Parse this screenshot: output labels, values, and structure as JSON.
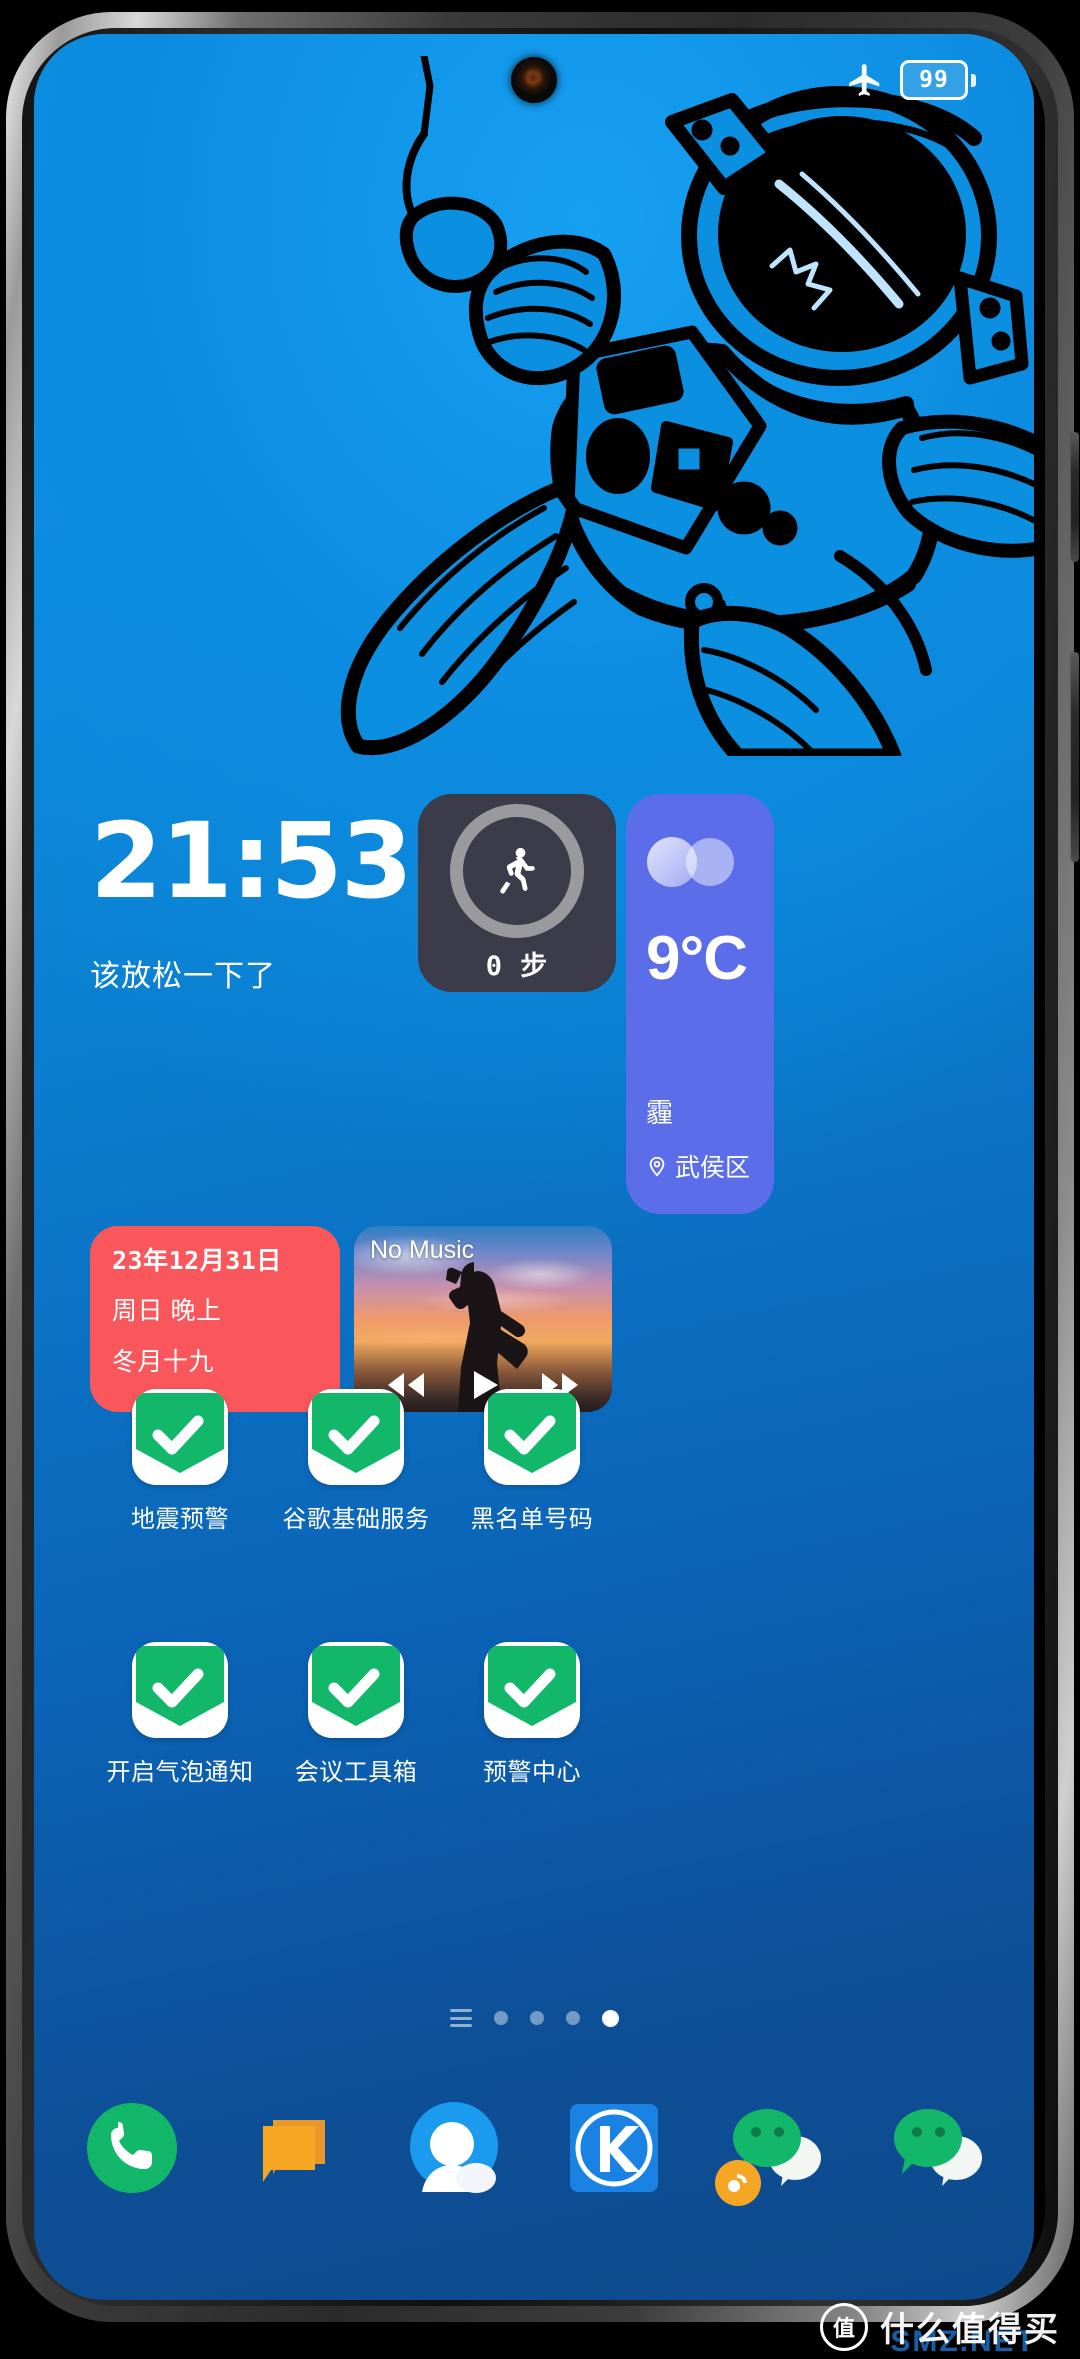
{
  "device": {
    "frame": "smartphone-mockup",
    "screen_bg_color": "#0b8fe0"
  },
  "status_bar": {
    "airplane_icon": "airplane-icon",
    "battery_level": "99",
    "battery_icon": "battery-icon"
  },
  "wallpaper": {
    "subject": "astronaut-line-art",
    "background_color": "#0b8fe0"
  },
  "widgets": {
    "clock": {
      "time": "21:53",
      "subtitle": "该放松一下了"
    },
    "steps": {
      "icon": "running-person-icon",
      "count_label": "0 步",
      "bg_color": "#3b3b4a"
    },
    "weather": {
      "icon": "haze-cloud-icon",
      "temperature": "9°C",
      "condition": "霾",
      "location_icon": "location-pin-icon",
      "location": "武侯区",
      "bg_color": "#5b6de8"
    },
    "calendar": {
      "date": "23年12月31日",
      "weekday": "周日 晚上",
      "lunar": "冬月十九",
      "bg_color": "#f9575c"
    },
    "music": {
      "title": "No Music",
      "prev_icon": "rewind-icon",
      "play_icon": "play-icon",
      "next_icon": "fast-forward-icon",
      "artwork": "sunset-photographer-silhouette"
    }
  },
  "app_grid": {
    "rows": [
      [
        {
          "label": "地震预警",
          "icon": "green-shield-check-icon"
        },
        {
          "label": "谷歌基础服务",
          "icon": "green-shield-check-icon"
        },
        {
          "label": "黑名单号码",
          "icon": "green-shield-check-icon"
        }
      ],
      [
        {
          "label": "开启气泡通知",
          "icon": "green-shield-check-icon"
        },
        {
          "label": "会议工具箱",
          "icon": "green-shield-check-icon"
        },
        {
          "label": "预警中心",
          "icon": "green-shield-check-icon"
        }
      ]
    ],
    "icon_color": "#12b76a"
  },
  "page_indicator": {
    "menu_icon": "hamburger-menu-icon",
    "total_pages": 4,
    "active_page": 4
  },
  "dock": {
    "items": [
      {
        "name": "phone",
        "icon": "phone-icon",
        "color": "#12b76a"
      },
      {
        "name": "messages",
        "icon": "message-bubbles-icon",
        "color": "#f5a623"
      },
      {
        "name": "contacts",
        "icon": "contacts-person-icon",
        "color": "#1a9bf0"
      },
      {
        "name": "k-app",
        "icon": "letter-k-icon",
        "color": "#1a82e2"
      },
      {
        "name": "wechat-dual",
        "icon": "wechat-icon",
        "color": "#12b76a",
        "badge_icon": "dual-app-badge-icon"
      },
      {
        "name": "wechat",
        "icon": "wechat-icon",
        "color": "#12b76a"
      }
    ]
  },
  "watermark": {
    "badge": "值",
    "text": "什么值得买",
    "sub": "SMZ.NET"
  }
}
